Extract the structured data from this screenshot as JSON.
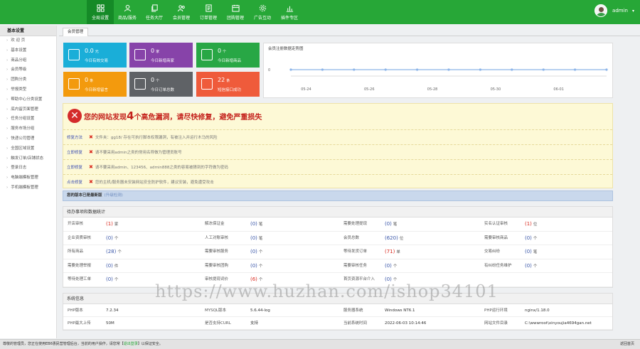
{
  "nav": [
    {
      "label": "全局设置",
      "icon": "grid-icon",
      "active": true
    },
    {
      "label": "商品/服务",
      "icon": "user-icon"
    },
    {
      "label": "任务大厅",
      "icon": "copy-icon"
    },
    {
      "label": "会员管理",
      "icon": "members-icon"
    },
    {
      "label": "订单管理",
      "icon": "list-icon"
    },
    {
      "label": "团购管理",
      "icon": "calendar-icon"
    },
    {
      "label": "广告互动",
      "icon": "gear-icon"
    },
    {
      "label": "插件专区",
      "icon": "chart-icon"
    }
  ],
  "user": {
    "name": "admin",
    "caret": "▾"
  },
  "sidebar": {
    "title": "基本设置",
    "items": [
      "欢 迎 页",
      "基本设置",
      "商品分组",
      "会员等级",
      "团购分类",
      "举报类型",
      "帮助中心分类设置",
      "底内留页面管理",
      "任务分组设置",
      "服务市场分组",
      "快递公司管理",
      "全国区域设置",
      "触发订单/店铺状态",
      "登录日志",
      "电脑端模板管理",
      "手机端模板管理"
    ]
  },
  "tab": "会员管理",
  "cards": [
    {
      "num": "0.0",
      "unit": "元",
      "label": "今日有效交易",
      "color": "#1aaed8",
      "icon": "money-icon"
    },
    {
      "num": "0",
      "unit": "家",
      "label": "今日新增商家",
      "color": "#8743a9",
      "icon": "clipboard-icon"
    },
    {
      "num": "0",
      "unit": "个",
      "label": "今日新增商品",
      "color": "#28a745",
      "icon": "chart-icon"
    },
    {
      "num": "0",
      "unit": "条",
      "label": "今日新增留言",
      "color": "#f39a0d",
      "icon": "mail-icon"
    },
    {
      "num": "0",
      "unit": "个",
      "label": "今日订单总数",
      "color": "#5f6266",
      "icon": "cart-icon"
    },
    {
      "num": "22",
      "unit": "条",
      "label": "短信接口成功",
      "color": "#ef5b3b",
      "icon": "plus-box-icon"
    }
  ],
  "chart_data": {
    "type": "line",
    "title": "会员注册数据走势图",
    "x": [
      "05-24",
      "05-26",
      "05-28",
      "05-30",
      "06-01",
      "06-03"
    ],
    "y_tick": "0",
    "series": [
      {
        "values": [
          0,
          0,
          0,
          0,
          0,
          0,
          0,
          0,
          0,
          0,
          0
        ]
      }
    ],
    "color": "#8ab3e8"
  },
  "warning": {
    "title_pre": "您的网站发现",
    "count": "4",
    "title_post": "个高危漏洞，请尽快修复，避免严重损失",
    "rows": [
      {
        "link": "修复方法",
        "text": "文件夹：gg18/ 存在可执行脚本权限漏洞，有被注入并运行木马的风险"
      },
      {
        "link": "立即修复",
        "text": "请不要采用admin之类的常用名称做为管理员账号"
      },
      {
        "link": "立即修复",
        "text": "请不要采用admin、123456、admin888之类的容易被猜到的字符做为密码"
      },
      {
        "link": "点击修复",
        "text": "您的主机/服务器未安装网站安全防护软件，建议安装，避免遭受攻击"
      }
    ]
  },
  "version": {
    "text": "您的版本已是最新版",
    "muted": "(升级检测)"
  },
  "stats": {
    "title": "待办事项和数据统计",
    "rows": [
      [
        {
          "l": "开店审核",
          "v": "1",
          "u": "家",
          "red": true
        },
        {
          "l": "解冻保证金",
          "v": "0",
          "u": "笔"
        },
        {
          "l": "需要处理提现",
          "v": "0",
          "u": "笔"
        },
        {
          "l": "实名认证审核",
          "v": "1",
          "u": "位",
          "red": true
        }
      ],
      [
        {
          "l": "企业资质审核",
          "v": "0",
          "u": "个"
        },
        {
          "l": "人工对账审核",
          "v": "0",
          "u": "笔"
        },
        {
          "l": "会员总数",
          "v": "620",
          "u": "位"
        },
        {
          "l": "需要审核商品",
          "v": "0",
          "u": "个"
        }
      ],
      [
        {
          "l": "所有商品",
          "v": "28",
          "u": "个"
        },
        {
          "l": "需要审核服务",
          "v": "0",
          "u": "个"
        },
        {
          "l": "等待发货订单",
          "v": "71",
          "u": "单",
          "red": true
        },
        {
          "l": "交易纠纷",
          "v": "0",
          "u": "笔"
        }
      ],
      [
        {
          "l": "需要处理举报",
          "v": "0",
          "u": "件"
        },
        {
          "l": "需要审核团购",
          "v": "0",
          "u": "个"
        },
        {
          "l": "需要审核任务",
          "v": "0",
          "u": "个"
        },
        {
          "l": "有纠纷任务维护",
          "v": "0",
          "u": "个"
        }
      ],
      [
        {
          "l": "等待处理工单",
          "v": "0",
          "u": "个"
        },
        {
          "l": "审核提现词价",
          "v": "6",
          "u": "个",
          "red": true
        },
        {
          "l": "首页资源平台介入",
          "v": "0",
          "u": "个"
        },
        {
          "l": "",
          "v": "",
          "u": ""
        }
      ]
    ]
  },
  "sysinfo": {
    "title": "系统信息",
    "rows": [
      [
        {
          "l": "PHP版本",
          "v": "7.2.34"
        },
        {
          "l": "MYSQL版本",
          "v": "5.6.44-log"
        },
        {
          "l": "服务器系统",
          "v": "Windows NT6.1"
        },
        {
          "l": "PHP运行环境",
          "v": "nginx/1.18.0"
        }
      ],
      [
        {
          "l": "PHP最大上传",
          "v": "50M"
        },
        {
          "l": "是否支持CURL",
          "v": "支持"
        },
        {
          "l": "当前系统时间",
          "v": "2022-06-03 10:14:46"
        },
        {
          "l": "网站文件目录",
          "v": "C:\\wwwroot\\xinyoujia4694gan.net"
        }
      ]
    ]
  },
  "footer": {
    "text": "尊敬的管理员，您正在使用EB6惠民营管理后台，当前的用户操作，请您常【",
    "link": "退出登录",
    "text2": "】以保证安全。",
    "right": "返回首页"
  },
  "watermark": "https://www.huzhan.com/ishop34101"
}
